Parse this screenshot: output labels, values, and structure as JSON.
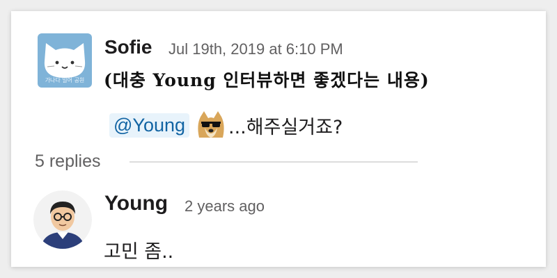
{
  "thread": {
    "message": {
      "author": "Sofie",
      "timestamp": "Jul 19th, 2019 at 6:10 PM",
      "avatar_caption": "가나다 일어 공원",
      "line1": "(대충 Young 인터뷰하면 좋겠다는 내용)",
      "mention": "@Young",
      "emoji": "doge-sunglasses",
      "line2": "...해주실거죠?"
    },
    "replies_label": "5 replies",
    "reply": {
      "author": "Young",
      "timestamp": "2 years ago",
      "text": "고민 좀.."
    }
  },
  "colors": {
    "mention_bg": "#e8f3fb",
    "mention_text": "#1264a3",
    "avatar_bg": "#7fb3d8",
    "muted_text": "#616061"
  }
}
